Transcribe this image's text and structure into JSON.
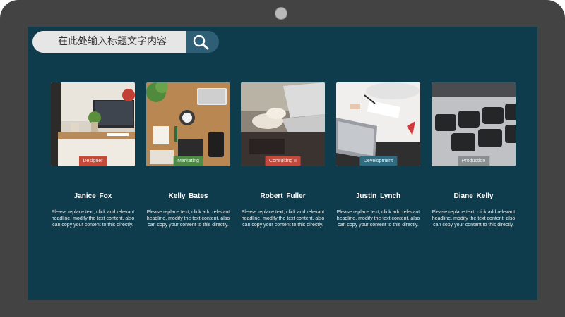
{
  "search": {
    "placeholder": "在此处输入标题文字内容",
    "icon": "search-icon"
  },
  "colors": {
    "screen": "#0f3c4c",
    "bezel": "#434343",
    "search_button": "#2f5f77"
  },
  "cards": [
    {
      "tag": "Designer",
      "tag_color": "#c44a3a",
      "name": "Janice  Fox",
      "description": "Please replace text, click add relevant headline, modify the text content, also can copy your content to this directly."
    },
    {
      "tag": "Marketing",
      "tag_color": "#4e8a45",
      "name": "Kelly  Bates",
      "description": "Please replace text, click add relevant headline, modify the text content, also can copy your content to this directly."
    },
    {
      "tag": "Consulting II",
      "tag_color": "#c14a3c",
      "name": "Robert  Fuller",
      "description": "Please replace text, click add relevant headline, modify the text content, also can copy your content to this directly."
    },
    {
      "tag": "Development",
      "tag_color": "#2e6b80",
      "name": "Justin  Lynch",
      "description": "Please replace text, click add relevant headline, modify the text content, also can copy your content to this directly."
    },
    {
      "tag": "Production",
      "tag_color": "#8a8f92",
      "name": "Diane  Kelly",
      "description": "Please replace text, click add relevant headline, modify the text content, also can copy your content to this directly."
    }
  ]
}
